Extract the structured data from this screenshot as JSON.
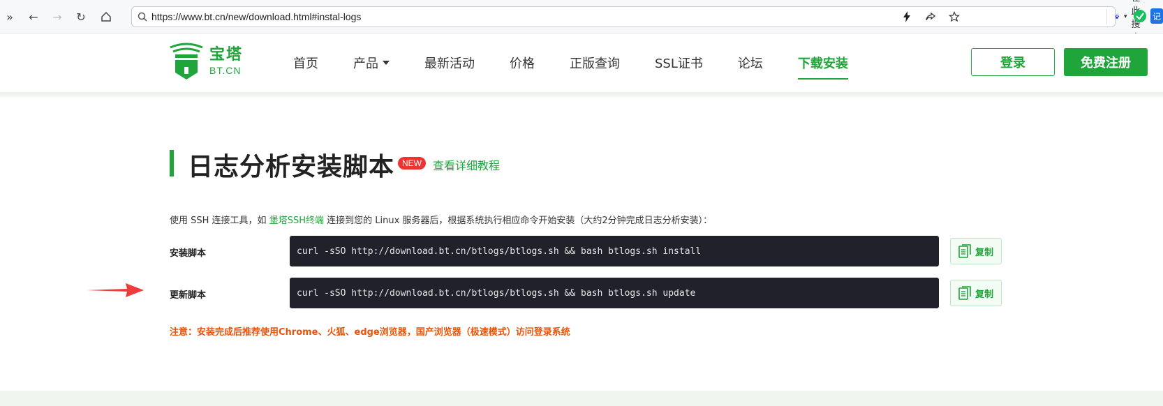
{
  "browser": {
    "url": "https://www.bt.cn/new/download.html#instal-logs",
    "search_placeholder": "在此搜索",
    "ext_label": "记"
  },
  "logo": {
    "cn": "宝塔",
    "en": "BT.CN"
  },
  "nav": {
    "items": [
      {
        "label": "首页"
      },
      {
        "label": "产品"
      },
      {
        "label": "最新活动"
      },
      {
        "label": "价格"
      },
      {
        "label": "正版查询"
      },
      {
        "label": "SSL证书"
      },
      {
        "label": "论坛"
      },
      {
        "label": "下载安装"
      }
    ],
    "login": "登录",
    "register": "免费注册"
  },
  "section": {
    "title": "日志分析安装脚本",
    "badge": "NEW",
    "tutorial": "查看详细教程",
    "desc_pre": "使用 SSH 连接工具，如 ",
    "desc_link": "堡塔SSH终端",
    "desc_post": " 连接到您的 Linux 服务器后，根据系统执行相应命令开始安装（大约2分钟完成日志分析安装）：",
    "install_label": "安装脚本",
    "install_cmd": "curl -sSO http://download.bt.cn/btlogs/btlogs.sh && bash btlogs.sh install",
    "update_label": "更新脚本",
    "update_cmd": "curl -sSO http://download.bt.cn/btlogs/btlogs.sh && bash btlogs.sh update",
    "copy": "复制",
    "notice": "注意：安装完成后推荐使用Chrome、火狐、edge浏览器，国产浏览器（极速模式）访问登录系统"
  },
  "colors": {
    "brand": "#20a53a",
    "code_bg": "#20212b",
    "notice": "#e8540a",
    "badge": "#e33333"
  }
}
